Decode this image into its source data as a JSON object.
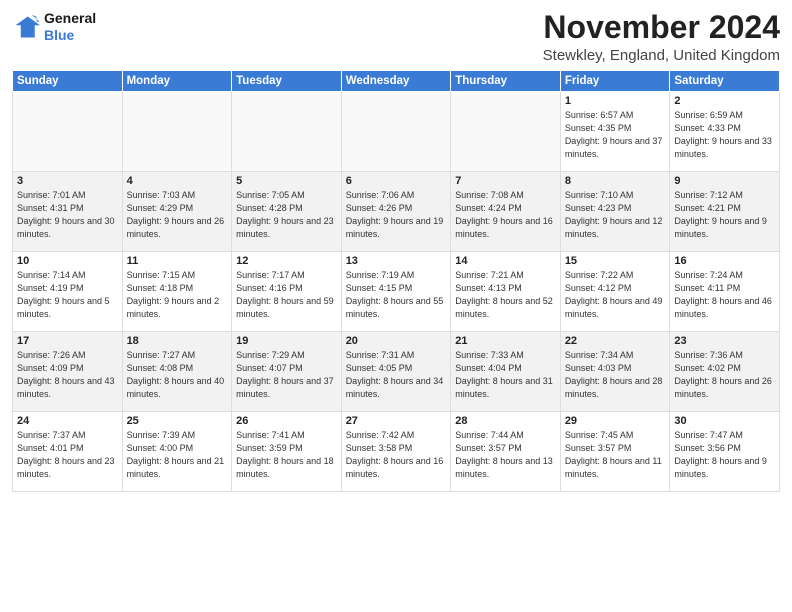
{
  "logo": {
    "line1": "General",
    "line2": "Blue"
  },
  "title": "November 2024",
  "location": "Stewkley, England, United Kingdom",
  "days_of_week": [
    "Sunday",
    "Monday",
    "Tuesday",
    "Wednesday",
    "Thursday",
    "Friday",
    "Saturday"
  ],
  "weeks": [
    [
      {
        "day": "",
        "info": ""
      },
      {
        "day": "",
        "info": ""
      },
      {
        "day": "",
        "info": ""
      },
      {
        "day": "",
        "info": ""
      },
      {
        "day": "",
        "info": ""
      },
      {
        "day": "1",
        "info": "Sunrise: 6:57 AM\nSunset: 4:35 PM\nDaylight: 9 hours and 37 minutes."
      },
      {
        "day": "2",
        "info": "Sunrise: 6:59 AM\nSunset: 4:33 PM\nDaylight: 9 hours and 33 minutes."
      }
    ],
    [
      {
        "day": "3",
        "info": "Sunrise: 7:01 AM\nSunset: 4:31 PM\nDaylight: 9 hours and 30 minutes."
      },
      {
        "day": "4",
        "info": "Sunrise: 7:03 AM\nSunset: 4:29 PM\nDaylight: 9 hours and 26 minutes."
      },
      {
        "day": "5",
        "info": "Sunrise: 7:05 AM\nSunset: 4:28 PM\nDaylight: 9 hours and 23 minutes."
      },
      {
        "day": "6",
        "info": "Sunrise: 7:06 AM\nSunset: 4:26 PM\nDaylight: 9 hours and 19 minutes."
      },
      {
        "day": "7",
        "info": "Sunrise: 7:08 AM\nSunset: 4:24 PM\nDaylight: 9 hours and 16 minutes."
      },
      {
        "day": "8",
        "info": "Sunrise: 7:10 AM\nSunset: 4:23 PM\nDaylight: 9 hours and 12 minutes."
      },
      {
        "day": "9",
        "info": "Sunrise: 7:12 AM\nSunset: 4:21 PM\nDaylight: 9 hours and 9 minutes."
      }
    ],
    [
      {
        "day": "10",
        "info": "Sunrise: 7:14 AM\nSunset: 4:19 PM\nDaylight: 9 hours and 5 minutes."
      },
      {
        "day": "11",
        "info": "Sunrise: 7:15 AM\nSunset: 4:18 PM\nDaylight: 9 hours and 2 minutes."
      },
      {
        "day": "12",
        "info": "Sunrise: 7:17 AM\nSunset: 4:16 PM\nDaylight: 8 hours and 59 minutes."
      },
      {
        "day": "13",
        "info": "Sunrise: 7:19 AM\nSunset: 4:15 PM\nDaylight: 8 hours and 55 minutes."
      },
      {
        "day": "14",
        "info": "Sunrise: 7:21 AM\nSunset: 4:13 PM\nDaylight: 8 hours and 52 minutes."
      },
      {
        "day": "15",
        "info": "Sunrise: 7:22 AM\nSunset: 4:12 PM\nDaylight: 8 hours and 49 minutes."
      },
      {
        "day": "16",
        "info": "Sunrise: 7:24 AM\nSunset: 4:11 PM\nDaylight: 8 hours and 46 minutes."
      }
    ],
    [
      {
        "day": "17",
        "info": "Sunrise: 7:26 AM\nSunset: 4:09 PM\nDaylight: 8 hours and 43 minutes."
      },
      {
        "day": "18",
        "info": "Sunrise: 7:27 AM\nSunset: 4:08 PM\nDaylight: 8 hours and 40 minutes."
      },
      {
        "day": "19",
        "info": "Sunrise: 7:29 AM\nSunset: 4:07 PM\nDaylight: 8 hours and 37 minutes."
      },
      {
        "day": "20",
        "info": "Sunrise: 7:31 AM\nSunset: 4:05 PM\nDaylight: 8 hours and 34 minutes."
      },
      {
        "day": "21",
        "info": "Sunrise: 7:33 AM\nSunset: 4:04 PM\nDaylight: 8 hours and 31 minutes."
      },
      {
        "day": "22",
        "info": "Sunrise: 7:34 AM\nSunset: 4:03 PM\nDaylight: 8 hours and 28 minutes."
      },
      {
        "day": "23",
        "info": "Sunrise: 7:36 AM\nSunset: 4:02 PM\nDaylight: 8 hours and 26 minutes."
      }
    ],
    [
      {
        "day": "24",
        "info": "Sunrise: 7:37 AM\nSunset: 4:01 PM\nDaylight: 8 hours and 23 minutes."
      },
      {
        "day": "25",
        "info": "Sunrise: 7:39 AM\nSunset: 4:00 PM\nDaylight: 8 hours and 21 minutes."
      },
      {
        "day": "26",
        "info": "Sunrise: 7:41 AM\nSunset: 3:59 PM\nDaylight: 8 hours and 18 minutes."
      },
      {
        "day": "27",
        "info": "Sunrise: 7:42 AM\nSunset: 3:58 PM\nDaylight: 8 hours and 16 minutes."
      },
      {
        "day": "28",
        "info": "Sunrise: 7:44 AM\nSunset: 3:57 PM\nDaylight: 8 hours and 13 minutes."
      },
      {
        "day": "29",
        "info": "Sunrise: 7:45 AM\nSunset: 3:57 PM\nDaylight: 8 hours and 11 minutes."
      },
      {
        "day": "30",
        "info": "Sunrise: 7:47 AM\nSunset: 3:56 PM\nDaylight: 8 hours and 9 minutes."
      }
    ]
  ]
}
